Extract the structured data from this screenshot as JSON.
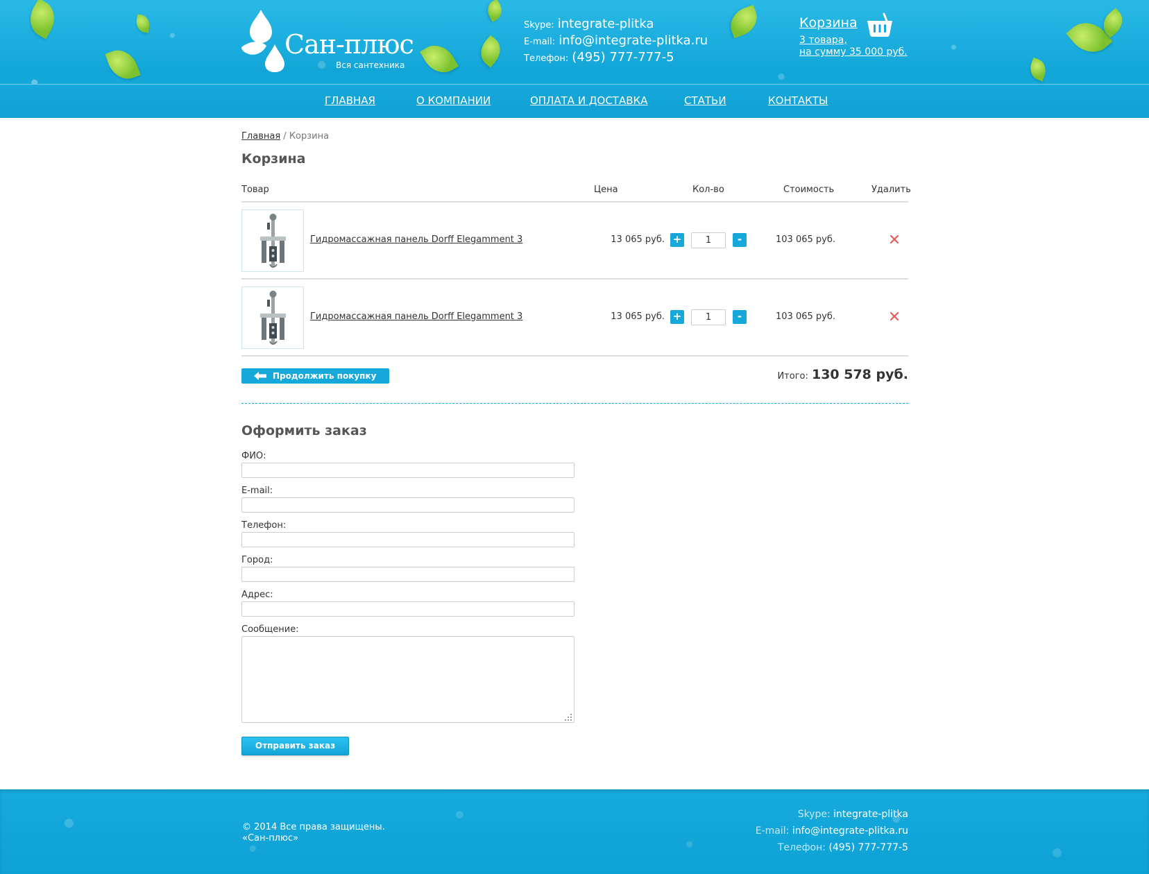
{
  "header": {
    "logo_title": "Сан-плюс",
    "logo_subtitle": "Вся сантехника",
    "contacts": {
      "skype_label": "Skype:",
      "skype": "integrate-plitka",
      "email_label": "E-mail:",
      "email": "info@integrate-plitka.ru",
      "phone_label": "Телефон:",
      "phone": "(495) 777-777-5"
    },
    "cart": {
      "title": "Корзина",
      "line1": "3 товара,",
      "line2": "на сумму 35 000 руб."
    }
  },
  "nav": [
    {
      "label": "ГЛАВНАЯ"
    },
    {
      "label": "О КОМПАНИИ"
    },
    {
      "label": "ОПЛАТА И ДОСТАВКА"
    },
    {
      "label": "СТАТЬИ"
    },
    {
      "label": "КОНТАКТЫ"
    }
  ],
  "breadcrumb": {
    "home": "Главная",
    "separator": "/",
    "current": "Корзина"
  },
  "page_title": "Корзина",
  "table": {
    "headers": {
      "product": "Товар",
      "price": "Цена",
      "qty": "Кол-во",
      "cost": "Стоимость",
      "delete": "Удалить"
    },
    "rows": [
      {
        "name": "Гидромассажная панель Dorff Elegamment 3",
        "price": "13 065 руб.",
        "qty": "1",
        "cost": "103 065 руб."
      },
      {
        "name": "Гидромассажная панель Dorff Elegamment 3",
        "price": "13 065 руб.",
        "qty": "1",
        "cost": "103 065 руб."
      }
    ],
    "plus": "+",
    "minus": "-"
  },
  "continue_label": "Продолжить покупку",
  "total": {
    "label": "Итого:",
    "value": "130 578 руб."
  },
  "order": {
    "title": "Оформить заказ",
    "fields": {
      "name": "ФИО:",
      "email": "E-mail:",
      "phone": "Телефон:",
      "city": "Город:",
      "address": "Адрес:",
      "message": "Сообщение:"
    },
    "submit": "Отправить заказ"
  },
  "footer": {
    "copyright_line1": "© 2014 Все права защищены.",
    "copyright_line2": "«Сан-плюс»",
    "skype_label": "Skype:",
    "skype": "integrate-plitka",
    "email_label": "E-mail:",
    "email": "info@integrate-plitka.ru",
    "phone_label": "Телефон:",
    "phone": "(495) 777-777-5"
  },
  "colors": {
    "accent": "#17a8db",
    "leaf": "#7cc22e",
    "delete": "#e85a5a"
  }
}
